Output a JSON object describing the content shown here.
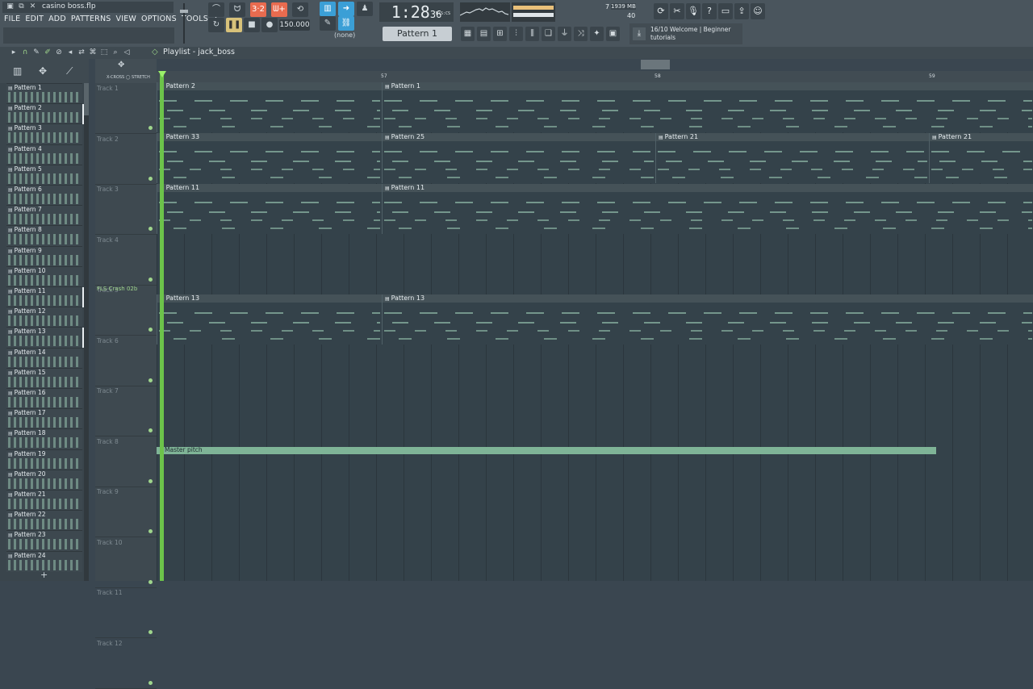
{
  "window": {
    "filename": "casino boss.flp"
  },
  "menu": [
    "FILE",
    "EDIT",
    "ADD",
    "PATTERNS",
    "VIEW",
    "OPTIONS",
    "TOOLS",
    "?"
  ],
  "transport": {
    "time_main": "1:28",
    "time_sub": "36",
    "time_unit": "M:S:CS",
    "tempo": "150.000",
    "snap_none": "(none)"
  },
  "pattern_selector": "Pattern 1",
  "memory": {
    "value": "7",
    "mb": "1939 MB",
    "poly": "40"
  },
  "hint": {
    "counter": "16/10",
    "line1": "Welcome | Beginner",
    "line2": "tutorials"
  },
  "playlist": {
    "title": "Playlist - jack_boss",
    "bar_numbers": [
      "57",
      "58",
      "59"
    ],
    "xcross": "X-CROSS",
    "stretch": "STRETCH"
  },
  "patterns": [
    "Pattern 1",
    "Pattern 2",
    "Pattern 3",
    "Pattern 4",
    "Pattern 5",
    "Pattern 6",
    "Pattern 7",
    "Pattern 8",
    "Pattern 9",
    "Pattern 10",
    "Pattern 11",
    "Pattern 12",
    "Pattern 13",
    "Pattern 14",
    "Pattern 15",
    "Pattern 16",
    "Pattern 17",
    "Pattern 18",
    "Pattern 19",
    "Pattern 20",
    "Pattern 21",
    "Pattern 22",
    "Pattern 23",
    "Pattern 24"
  ],
  "tracks": [
    "Track 1",
    "Track 2",
    "Track 3",
    "Track 4",
    "Track 5",
    "Track 6",
    "Track 7",
    "Track 8",
    "Track 9",
    "Track 10",
    "Track 11",
    "Track 12"
  ],
  "track5_label": "FLS Crash 02b",
  "clips": {
    "t1": [
      "Pattern 2",
      "Pattern 1"
    ],
    "t2": [
      "Pattern 33",
      "Pattern 25",
      "Pattern 21",
      "Pattern 21"
    ],
    "t3": [
      "Pattern 11",
      "Pattern 11"
    ],
    "t6": [
      "Pattern 13",
      "Pattern 13"
    ]
  },
  "automation": "Master pitch",
  "colors": {
    "accent_orange": "#e86b4f",
    "accent_blue": "#3b9fd6",
    "playhead": "#6cc34a",
    "note": "#a9dcc2"
  }
}
